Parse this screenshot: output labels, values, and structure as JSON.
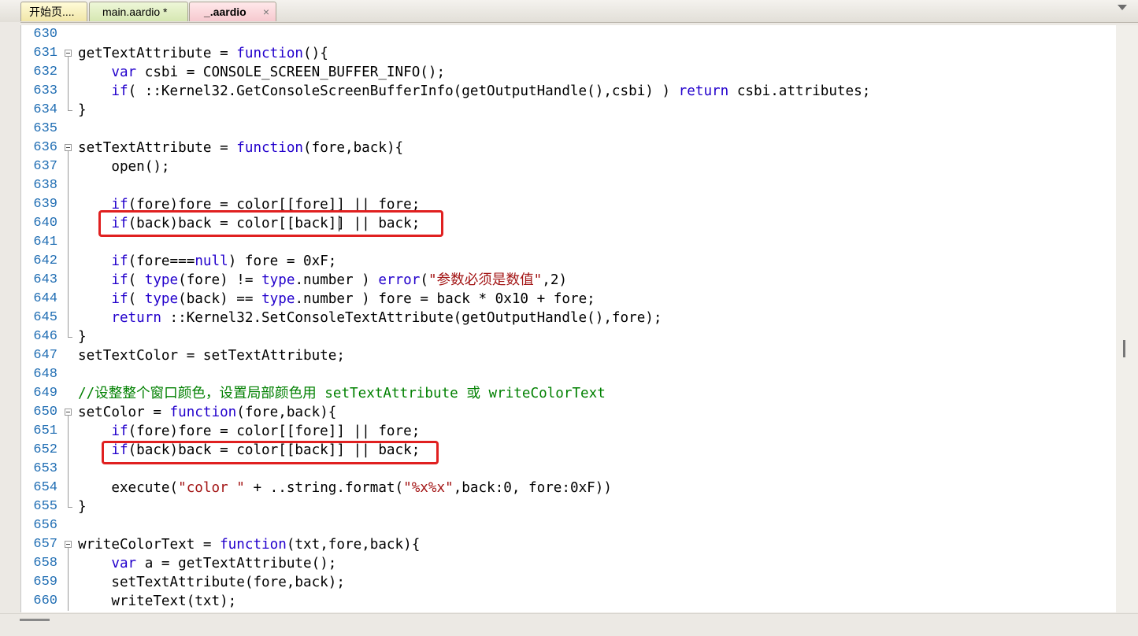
{
  "tabs": [
    {
      "label": "开始页....",
      "active": false
    },
    {
      "label": "main.aardio *",
      "active": false
    },
    {
      "label": "_.aardio",
      "active": true,
      "close": "×"
    }
  ],
  "colors": {
    "keyword": "#2200cc",
    "string": "#a31515",
    "comment": "#008000",
    "line_number": "#1f6db3",
    "highlight_box": "#e02020"
  },
  "lines": [
    {
      "n": "630",
      "parts": []
    },
    {
      "n": "631",
      "fold": "start",
      "parts": [
        [
          "",
          "getTextAttribute = "
        ],
        [
          "kw",
          "function"
        ],
        [
          "",
          "(){"
        ]
      ]
    },
    {
      "n": "632",
      "fold": "mid",
      "parts": [
        [
          "",
          "    "
        ],
        [
          "kw",
          "var"
        ],
        [
          "",
          " csbi = CONSOLE_SCREEN_BUFFER_INFO();"
        ]
      ]
    },
    {
      "n": "633",
      "fold": "mid",
      "parts": [
        [
          "",
          "    "
        ],
        [
          "kw",
          "if"
        ],
        [
          "",
          "( ::Kernel32.GetConsoleScreenBufferInfo(getOutputHandle(),csbi) ) "
        ],
        [
          "kw",
          "return"
        ],
        [
          "",
          " csbi.attributes;"
        ]
      ]
    },
    {
      "n": "634",
      "fold": "end",
      "parts": [
        [
          "",
          "}"
        ]
      ]
    },
    {
      "n": "635",
      "parts": []
    },
    {
      "n": "636",
      "fold": "start",
      "parts": [
        [
          "",
          "setTextAttribute = "
        ],
        [
          "kw",
          "function"
        ],
        [
          "",
          "(fore,back){"
        ]
      ]
    },
    {
      "n": "637",
      "fold": "mid",
      "parts": [
        [
          "",
          "    open();"
        ]
      ]
    },
    {
      "n": "638",
      "fold": "mid",
      "parts": []
    },
    {
      "n": "639",
      "fold": "mid",
      "parts": [
        [
          "",
          "    "
        ],
        [
          "kw",
          "if"
        ],
        [
          "",
          "(fore)fore = color[[fore]] || fore;"
        ]
      ]
    },
    {
      "n": "640",
      "fold": "mid",
      "parts": [
        [
          "",
          "    "
        ],
        [
          "kw",
          "if"
        ],
        [
          "",
          "(back)back = color[[back]] || back;"
        ]
      ]
    },
    {
      "n": "641",
      "fold": "mid",
      "parts": []
    },
    {
      "n": "642",
      "fold": "mid",
      "parts": [
        [
          "",
          "    "
        ],
        [
          "kw",
          "if"
        ],
        [
          "",
          "(fore==="
        ],
        [
          "kw",
          "null"
        ],
        [
          "",
          ") fore = 0xF;"
        ]
      ]
    },
    {
      "n": "643",
      "fold": "mid",
      "parts": [
        [
          "",
          "    "
        ],
        [
          "kw",
          "if"
        ],
        [
          "",
          "( "
        ],
        [
          "kw",
          "type"
        ],
        [
          "",
          "(fore) != "
        ],
        [
          "kw",
          "type"
        ],
        [
          "",
          ".number ) "
        ],
        [
          "kw",
          "error"
        ],
        [
          "",
          "("
        ],
        [
          "str",
          "\"参数必须是数值\""
        ],
        [
          "",
          ",2)"
        ]
      ]
    },
    {
      "n": "644",
      "fold": "mid",
      "parts": [
        [
          "",
          "    "
        ],
        [
          "kw",
          "if"
        ],
        [
          "",
          "( "
        ],
        [
          "kw",
          "type"
        ],
        [
          "",
          "(back) == "
        ],
        [
          "kw",
          "type"
        ],
        [
          "",
          ".number ) fore = back * 0x10 + fore;"
        ]
      ]
    },
    {
      "n": "645",
      "fold": "mid",
      "parts": [
        [
          "",
          "    "
        ],
        [
          "kw",
          "return"
        ],
        [
          "",
          " ::Kernel32.SetConsoleTextAttribute(getOutputHandle(),fore);"
        ]
      ]
    },
    {
      "n": "646",
      "fold": "end",
      "parts": [
        [
          "",
          "}"
        ]
      ]
    },
    {
      "n": "647",
      "parts": [
        [
          "",
          "setTextColor = setTextAttribute;"
        ]
      ]
    },
    {
      "n": "648",
      "parts": []
    },
    {
      "n": "649",
      "parts": [
        [
          "cmt",
          "//设整整个窗口颜色，设置局部颜色用 setTextAttribute 或 writeColorText"
        ]
      ]
    },
    {
      "n": "650",
      "fold": "start",
      "parts": [
        [
          "",
          "setColor = "
        ],
        [
          "kw",
          "function"
        ],
        [
          "",
          "(fore,back){"
        ]
      ]
    },
    {
      "n": "651",
      "fold": "mid",
      "parts": [
        [
          "",
          "    "
        ],
        [
          "kw",
          "if"
        ],
        [
          "",
          "(fore)fore = color[[fore]] || fore;"
        ]
      ]
    },
    {
      "n": "652",
      "fold": "mid",
      "parts": [
        [
          "",
          "    "
        ],
        [
          "kw",
          "if"
        ],
        [
          "",
          "(back)back = color[[back]] || back;"
        ]
      ]
    },
    {
      "n": "653",
      "fold": "mid",
      "parts": []
    },
    {
      "n": "654",
      "fold": "mid",
      "parts": [
        [
          "",
          "    execute("
        ],
        [
          "str",
          "\"color \""
        ],
        [
          "",
          " + ..string.format("
        ],
        [
          "str",
          "\"%x%x\""
        ],
        [
          "",
          ",back:0, fore:0xF))"
        ]
      ]
    },
    {
      "n": "655",
      "fold": "end",
      "parts": [
        [
          "",
          "}"
        ]
      ]
    },
    {
      "n": "656",
      "parts": []
    },
    {
      "n": "657",
      "fold": "start",
      "parts": [
        [
          "",
          "writeColorText = "
        ],
        [
          "kw",
          "function"
        ],
        [
          "",
          "(txt,fore,back){"
        ]
      ]
    },
    {
      "n": "658",
      "fold": "mid",
      "parts": [
        [
          "",
          "    "
        ],
        [
          "kw",
          "var"
        ],
        [
          "",
          " a = getTextAttribute();"
        ]
      ]
    },
    {
      "n": "659",
      "fold": "mid",
      "parts": [
        [
          "",
          "    setTextAttribute(fore,back);"
        ]
      ]
    },
    {
      "n": "660",
      "fold": "mid",
      "parts": [
        [
          "",
          "    writeText(txt);"
        ]
      ]
    }
  ]
}
